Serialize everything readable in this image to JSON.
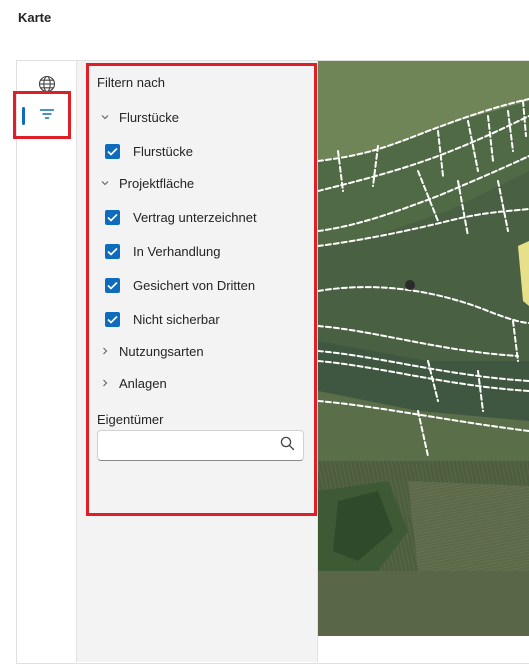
{
  "header": {
    "title": "Karte"
  },
  "rail": {
    "items": [
      {
        "icon": "globe-icon",
        "active": false
      },
      {
        "icon": "filter-icon",
        "active": true
      }
    ]
  },
  "filter_panel": {
    "heading": "Filtern nach",
    "groups": [
      {
        "label": "Flurstücke",
        "expanded": true,
        "items": [
          {
            "label": "Flurstücke",
            "checked": true
          }
        ]
      },
      {
        "label": "Projektfläche",
        "expanded": true,
        "items": [
          {
            "label": "Vertrag unterzeichnet",
            "checked": true
          },
          {
            "label": "In Verhandlung",
            "checked": true
          },
          {
            "label": "Gesichert von Dritten",
            "checked": true
          },
          {
            "label": "Nicht sicherbar",
            "checked": true
          }
        ]
      },
      {
        "label": "Nutzungsarten",
        "expanded": false,
        "items": []
      },
      {
        "label": "Anlagen",
        "expanded": false,
        "items": []
      }
    ],
    "owner": {
      "label": "Eigentümer",
      "value": "",
      "placeholder": ""
    }
  },
  "colors": {
    "accent": "#0f6cbd",
    "highlight": "#e01e27",
    "panel_bg": "#f3f3f3"
  }
}
